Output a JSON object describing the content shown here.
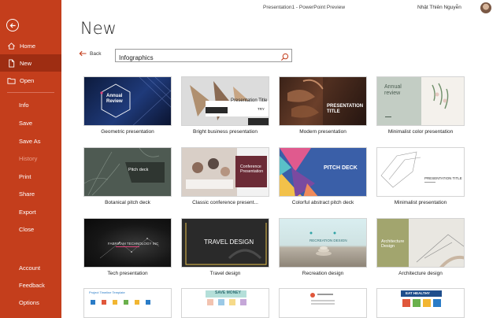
{
  "titlebar": {
    "doc_title": "Presentation1  -  PowerPoint Preview",
    "user_name": "Nhật Thiên Nguyễn"
  },
  "sidebar": {
    "primary": [
      "Home",
      "New",
      "Open"
    ],
    "secondary": [
      "Info",
      "Save",
      "Save As",
      "History",
      "Print",
      "Share",
      "Export",
      "Close"
    ],
    "footer": [
      "Account",
      "Feedback",
      "Options"
    ]
  },
  "main": {
    "title": "New",
    "back_label": "Back",
    "search_value": "Infographics",
    "templates": [
      {
        "caption": "Geometric presentation",
        "text": "Annual Review"
      },
      {
        "caption": "Bright business presentation",
        "text": "Presentation Title",
        "sub": "TRY"
      },
      {
        "caption": "Modern presentation",
        "text": "PRESENTATION TITLE"
      },
      {
        "caption": "Minimalist color presentation",
        "text": "Annual review"
      },
      {
        "caption": "Botanical pitch deck",
        "text": "Pitch deck"
      },
      {
        "caption": "Classic conference present...",
        "text": "Conference Presentation"
      },
      {
        "caption": "Colorful abstract pitch deck",
        "text": "PITCH DECK"
      },
      {
        "caption": "Minimalist presentation",
        "text": "PRESENTATION TITLE"
      },
      {
        "caption": "Tech presentation",
        "text": "FABRIKAM TECHNOLOGY INC"
      },
      {
        "caption": "Travel design",
        "text": "TRAVEL DESIGN"
      },
      {
        "caption": "Recreation design",
        "text": "RECREATION DESIGN"
      },
      {
        "caption": "Architecture design",
        "text": "Architecture Design"
      }
    ],
    "partial_row": [
      "Project Timeline Template",
      "SAVE MONEY",
      "",
      "EAT HEALTHY"
    ]
  },
  "colors": {
    "accent": "#c43e1c",
    "accent_dark": "#9e2d12"
  }
}
